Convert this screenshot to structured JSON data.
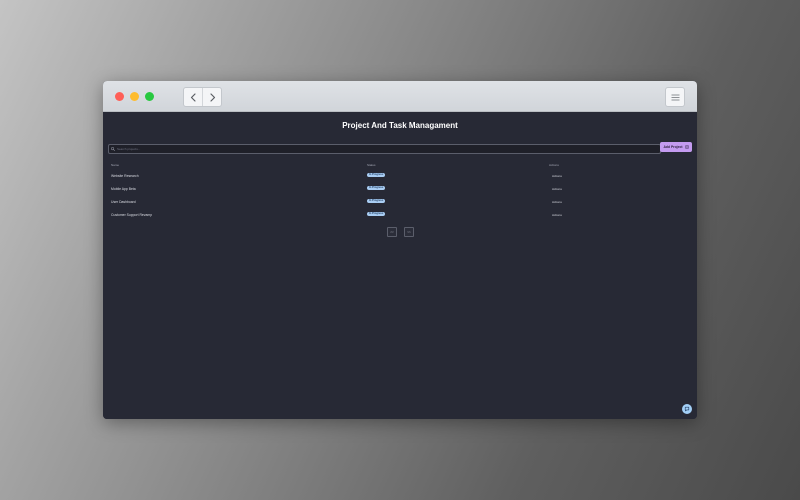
{
  "app": {
    "title": "Project And Task Managament"
  },
  "toolbar": {
    "back_icon": "chevron-left-icon",
    "forward_icon": "chevron-right-icon",
    "menu_icon": "hamburger-menu-icon"
  },
  "search": {
    "placeholder": "Search projects...",
    "value": ""
  },
  "add_button": {
    "label": "Add Project",
    "icon": "add-document-icon",
    "color": "#c49bf0"
  },
  "table": {
    "columns": [
      "Name",
      "Status",
      "Actions"
    ],
    "rows": [
      {
        "name": "Website Research",
        "status": "In Progress",
        "actions": "Actions"
      },
      {
        "name": "Mobile App Beta",
        "status": "In Progress",
        "actions": "Actions"
      },
      {
        "name": "User Dashboard",
        "status": "In Progress",
        "actions": "Actions"
      },
      {
        "name": "Customer Support Revamp",
        "status": "In Progress",
        "actions": "Actions"
      }
    ],
    "status_color": "#a9cdf3"
  },
  "pagination": {
    "prev": "<<",
    "next": ">>"
  },
  "fab": {
    "icon": "chat-icon",
    "color": "#a3cff7"
  },
  "colors": {
    "background": "#272935",
    "close": "#fe5f57",
    "minimize": "#febc2e",
    "zoom": "#28c840"
  }
}
